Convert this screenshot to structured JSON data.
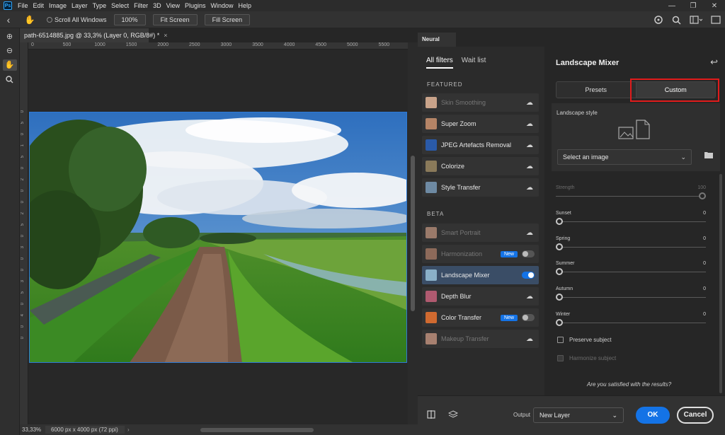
{
  "app": {
    "logo": "Ps"
  },
  "menu": [
    "File",
    "Edit",
    "Image",
    "Layer",
    "Type",
    "Select",
    "Filter",
    "3D",
    "View",
    "Plugins",
    "Window",
    "Help"
  ],
  "window_controls": {
    "minimize": "—",
    "restore": "❐",
    "close": "✕"
  },
  "options_bar": {
    "back_icon": "‹",
    "hand_icon": "✋",
    "scroll_all_windows": "Scroll All Windows",
    "zoom_100": "100%",
    "fit_screen": "Fit Screen",
    "fill_screen": "Fill Screen",
    "right_icons": [
      "share-icon",
      "search-icon",
      "workspace-icon",
      "window-arrange-icon"
    ]
  },
  "tools": [
    "zoom-in-icon",
    "zoom-out-icon",
    "hand-icon",
    "zoom-icon"
  ],
  "document": {
    "tab_title": "path-6514885.jpg @ 33,3% (Layer 0, RGB/8#) *",
    "close": "×",
    "ruler_top": [
      "0",
      "500",
      "1000",
      "1500",
      "2000",
      "2500",
      "3000",
      "3500",
      "4000",
      "4500",
      "5000",
      "5500"
    ],
    "ruler_left": [
      "0",
      "5",
      "0",
      "1",
      "5",
      "0",
      "2",
      "0",
      "0",
      "2",
      "5",
      "0",
      "3",
      "0",
      "0",
      "3",
      "5",
      "0",
      "4",
      "0",
      "0"
    ]
  },
  "status": {
    "zoom": "33,33%",
    "doc_info": "6000 px x 4000 px (72 ppi)",
    "arrow": "›"
  },
  "neural_filters": {
    "panel_tab": "Neural Filters",
    "tabs": [
      "All filters",
      "Wait list"
    ],
    "featured_title": "FEATURED",
    "beta_title": "BETA",
    "featured": [
      {
        "label": "Skin Smoothing",
        "disabled": true,
        "thumb": "#c9a38a"
      },
      {
        "label": "Super Zoom",
        "disabled": false,
        "thumb": "#b58466"
      },
      {
        "label": "JPEG Artefacts Removal",
        "disabled": false,
        "thumb": "#2a5aa8"
      },
      {
        "label": "Colorize",
        "disabled": false,
        "thumb": "#8a7a5a"
      },
      {
        "label": "Style Transfer",
        "disabled": false,
        "thumb": "#6e8aa3"
      }
    ],
    "beta": [
      {
        "label": "Smart Portrait",
        "disabled": true,
        "thumb": "#9a7a6a"
      },
      {
        "label": "Harmonization",
        "disabled": true,
        "thumb": "#8d6a5a",
        "badge": "New"
      },
      {
        "label": "Landscape Mixer",
        "disabled": false,
        "thumb": "#8ab0c8",
        "selected": true
      },
      {
        "label": "Depth Blur",
        "disabled": false,
        "thumb": "#b05a70"
      },
      {
        "label": "Color Transfer",
        "disabled": false,
        "thumb": "#d06a30",
        "badge": "New"
      },
      {
        "label": "Makeup Transfer",
        "disabled": true,
        "thumb": "#a78070"
      }
    ],
    "cloud_icon": "☁"
  },
  "settings": {
    "title": "Landscape Mixer",
    "reset_icon": "↩",
    "presets": "Presets",
    "custom": "Custom",
    "landscape_style": "Landscape style",
    "select_image": "Select an image",
    "chevron": "⌄",
    "folder_icon": "📁",
    "sliders": [
      {
        "name": "Strength",
        "value": "100",
        "level": 1.0,
        "disabled": true
      },
      {
        "name": "Sunset",
        "value": "0",
        "level": 0.0,
        "disabled": false
      },
      {
        "name": "Spring",
        "value": "0",
        "level": 0.0,
        "disabled": false
      },
      {
        "name": "Summer",
        "value": "0",
        "level": 0.0,
        "disabled": false
      },
      {
        "name": "Autumn",
        "value": "0",
        "level": 0.0,
        "disabled": false
      },
      {
        "name": "Winter",
        "value": "0",
        "level": 0.0,
        "disabled": false
      }
    ],
    "preserve_subject": "Preserve subject",
    "harmonize_subject": "Harmonize subject",
    "satisfied": "Are you satisfied with the results?"
  },
  "footer": {
    "output_label": "Output",
    "output_value": "New Layer",
    "ok": "OK",
    "cancel": "Cancel",
    "chevron": "⌄"
  },
  "colors": {
    "accent": "#1473e6",
    "highlight": "#e11b1b",
    "selection": "#2d7ad6"
  }
}
